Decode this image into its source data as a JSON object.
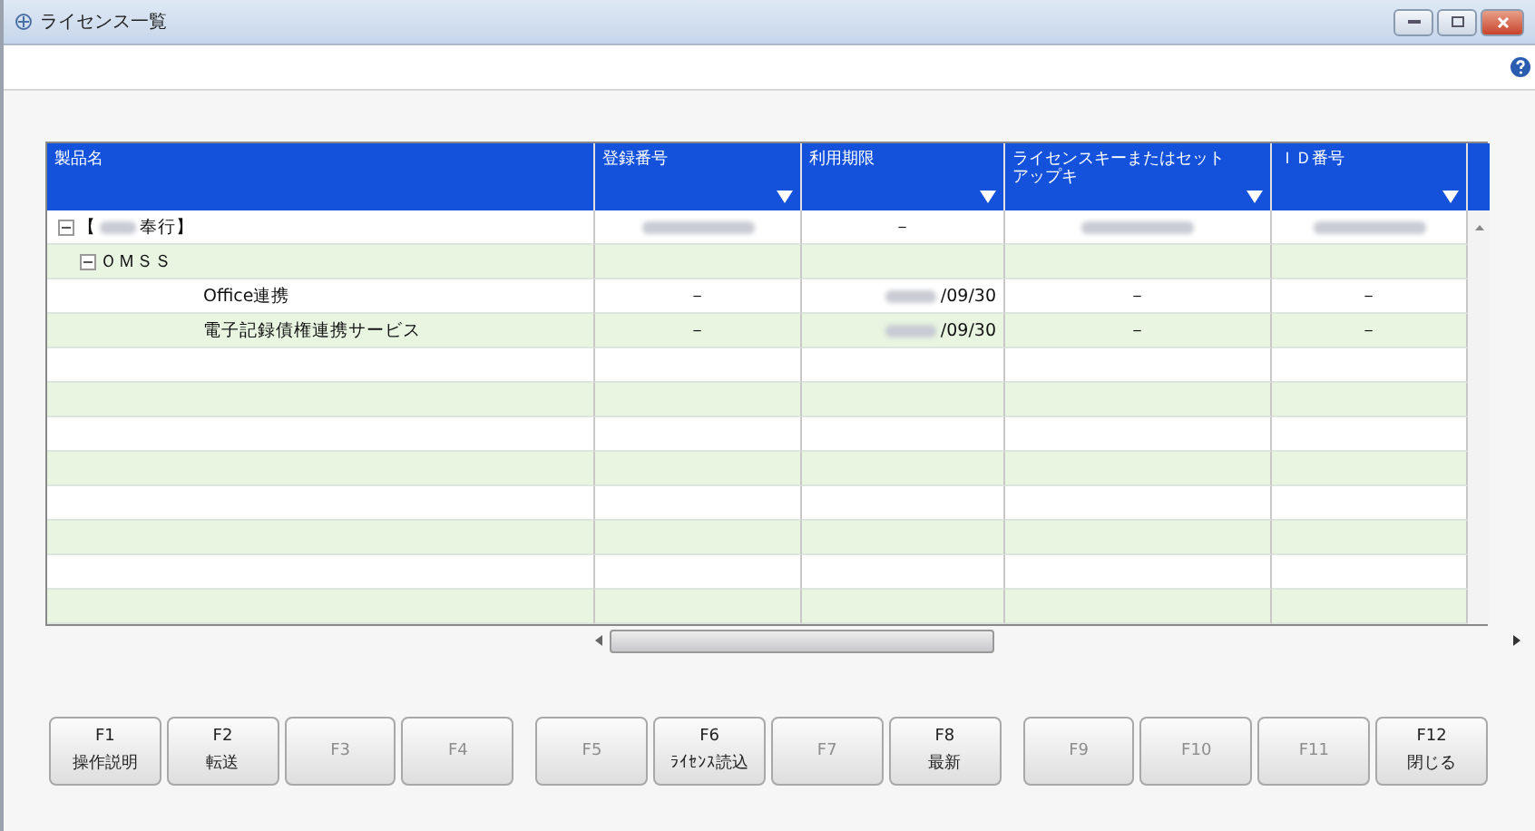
{
  "window": {
    "title": "ライセンス一覧"
  },
  "table": {
    "columns": [
      "製品名",
      "登録番号",
      "利用期限",
      "ライセンスキーまたはセットアップキ",
      "ＩＤ番号"
    ],
    "rows": [
      {
        "name": [
          {
            "kind": "text",
            "text": "【"
          },
          {
            "kind": "redacted"
          },
          {
            "kind": "text",
            "text": "奉行】"
          }
        ],
        "expanded": true,
        "cells": [
          {
            "kind": "redacted"
          },
          {
            "kind": "text",
            "text": "－"
          },
          {
            "kind": "redacted"
          },
          {
            "kind": "redacted"
          }
        ],
        "children": [
          {
            "name": [
              {
                "kind": "text",
                "text": "ＯＭＳＳ"
              }
            ],
            "expanded": true,
            "children": [
              {
                "name": [
                  {
                    "kind": "text",
                    "text": "Office連携"
                  }
                ],
                "cells": [
                  {
                    "kind": "text",
                    "text": "－"
                  },
                  {
                    "kind": "partly_redacted",
                    "text": "/09/30"
                  },
                  {
                    "kind": "text",
                    "text": "－"
                  },
                  {
                    "kind": "text",
                    "text": "－"
                  }
                ]
              },
              {
                "name": [
                  {
                    "kind": "text",
                    "text": "電子記録債権連携サービス"
                  }
                ],
                "cells": [
                  {
                    "kind": "text",
                    "text": "－"
                  },
                  {
                    "kind": "partly_redacted",
                    "text": "/09/30"
                  },
                  {
                    "kind": "text",
                    "text": "－"
                  },
                  {
                    "kind": "text",
                    "text": "－"
                  }
                ]
              }
            ]
          }
        ]
      }
    ]
  },
  "function_keys": [
    {
      "key": "F1",
      "label": "操作説明",
      "disabled": false
    },
    {
      "key": "F2",
      "label": "転送",
      "disabled": false
    },
    {
      "key": "F3",
      "disabled": true
    },
    {
      "key": "F4",
      "disabled": true
    },
    {
      "key": "F5",
      "disabled": true
    },
    {
      "key": "F6",
      "label": "ﾗｲｾﾝｽ読込",
      "disabled": false
    },
    {
      "key": "F7",
      "disabled": true
    },
    {
      "key": "F8",
      "label": "最新",
      "disabled": false
    },
    {
      "key": "F9",
      "disabled": true
    },
    {
      "key": "F10",
      "disabled": true
    },
    {
      "key": "F11",
      "disabled": true
    },
    {
      "key": "F12",
      "label": "閉じる",
      "disabled": false
    }
  ]
}
